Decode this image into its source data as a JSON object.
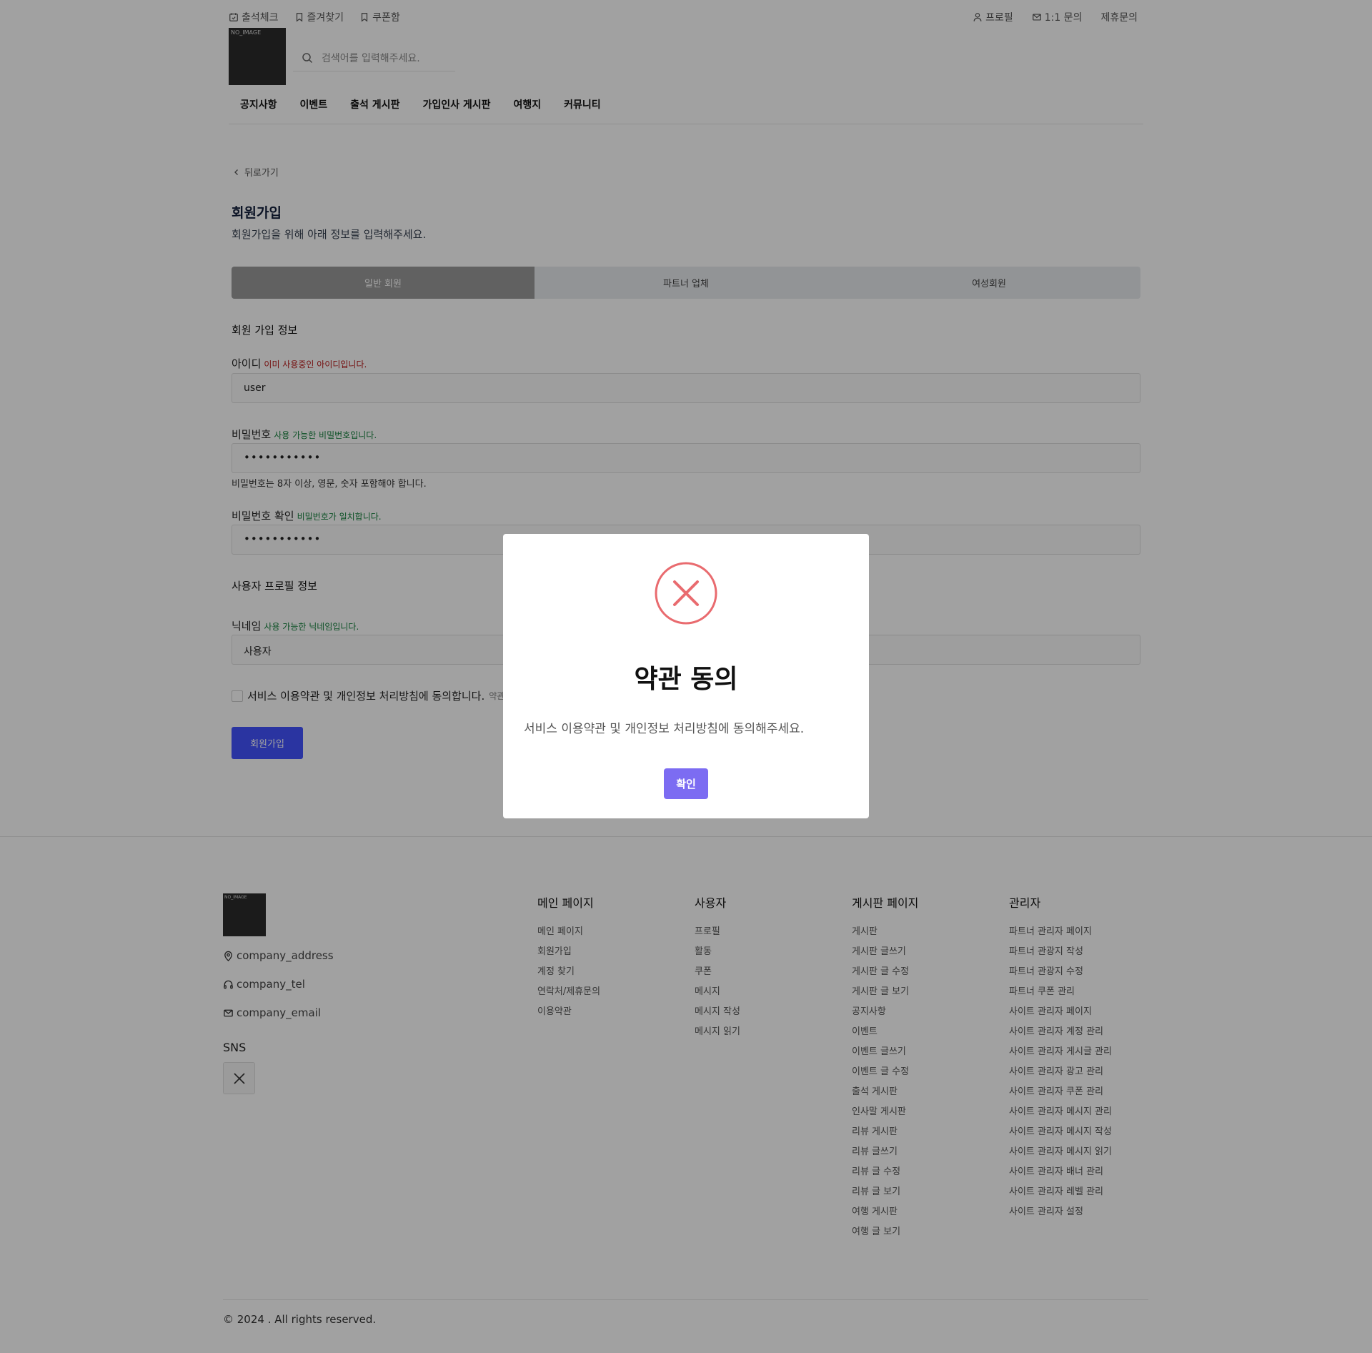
{
  "header": {
    "links_left": [
      "출석체크",
      "즐겨찾기",
      "쿠폰함"
    ],
    "links_right": [
      "프로필",
      "1:1 문의",
      "제휴문의"
    ],
    "logo_text": "NO_IMAGE",
    "search_placeholder": "검색어를 입력해주세요."
  },
  "nav": [
    "공지사항",
    "이벤트",
    "출석 게시판",
    "가입인사 게시판",
    "여행지",
    "커뮤니티"
  ],
  "back_label": "뒤로가기",
  "page": {
    "title": "회원가입",
    "subtitle": "회원가입을 위해 아래 정보를 입력해주세요."
  },
  "tabs": [
    "일반 회원",
    "파트너 업체",
    "여성회원"
  ],
  "form": {
    "section_account": "회원 가입 정보",
    "id_label": "아이디",
    "id_msg": "이미 사용중인 아이디입니다.",
    "id_value": "user",
    "pw_label": "비밀번호",
    "pw_msg": "사용 가능한 비밀번호입니다.",
    "pw_value": "•••••••••••",
    "pw_hint": "비밀번호는 8자 이상, 영문, 숫자 포함해야 합니다.",
    "pw2_label": "비밀번호 확인",
    "pw2_msg": "비밀번호가 일치합니다.",
    "pw2_value": "•••••••••••",
    "section_profile": "사용자 프로필 정보",
    "nick_label": "닉네임",
    "nick_msg": "사용 가능한 닉네임입니다.",
    "nick_value": "사용자",
    "agree_label": "서비스 이용약관 및 개인정보 처리방침에 동의합니다.",
    "agree_more": "약관",
    "submit_label": "회원가입"
  },
  "footer": {
    "logo_text": "NO_IMAGE",
    "address": "company_address",
    "tel": "company_tel",
    "email": "company_email",
    "sns_title": "SNS",
    "columns": [
      {
        "title": "메인 페이지",
        "items": [
          "메인 페이지",
          "회원가입",
          "계정 찾기",
          "연락처/제휴문의",
          "이용약관"
        ]
      },
      {
        "title": "사용자",
        "items": [
          "프로필",
          "활동",
          "쿠폰",
          "메시지",
          "메시지 작성",
          "메시지 읽기"
        ]
      },
      {
        "title": "게시판 페이지",
        "items": [
          "게시판",
          "게시판 글쓰기",
          "게시판 글 수정",
          "게시판 글 보기",
          "공지사항",
          "이벤트",
          "이벤트 글쓰기",
          "이벤트 글 수정",
          "출석 게시판",
          "인사말 게시판",
          "리뷰 게시판",
          "리뷰 글쓰기",
          "리뷰 글 수정",
          "리뷰 글 보기",
          "여행 게시판",
          "여행 글 보기"
        ]
      },
      {
        "title": "관리자",
        "items": [
          "파트너 관리자 페이지",
          "파트너 관광지 작성",
          "파트너 관광지 수정",
          "파트너 쿠폰 관리",
          "사이트 관리자 페이지",
          "사이트 관리자 계정 관리",
          "사이트 관리자 게시글 관리",
          "사이트 관리자 광고 관리",
          "사이트 관리자 쿠폰 관리",
          "사이트 관리자 메시지 관리",
          "사이트 관리자 메시지 작성",
          "사이트 관리자 메시지 읽기",
          "사이트 관리자 배너 관리",
          "사이트 관리자 레벨 관리",
          "사이트 관리자 설정"
        ]
      }
    ],
    "copyright": "© 2024 . All rights reserved."
  },
  "modal": {
    "icon": "error-x-circle-icon",
    "title": "약관 동의",
    "message": "서비스 이용약관 및 개인정보 처리방침에 동의해주세요.",
    "confirm_label": "확인",
    "colors": {
      "error": "#e96b6f",
      "confirm": "#7c6cf2"
    }
  },
  "colors": {
    "primary": "#4353ff",
    "error_text": "#b91c1c",
    "ok_text": "#15803d"
  }
}
